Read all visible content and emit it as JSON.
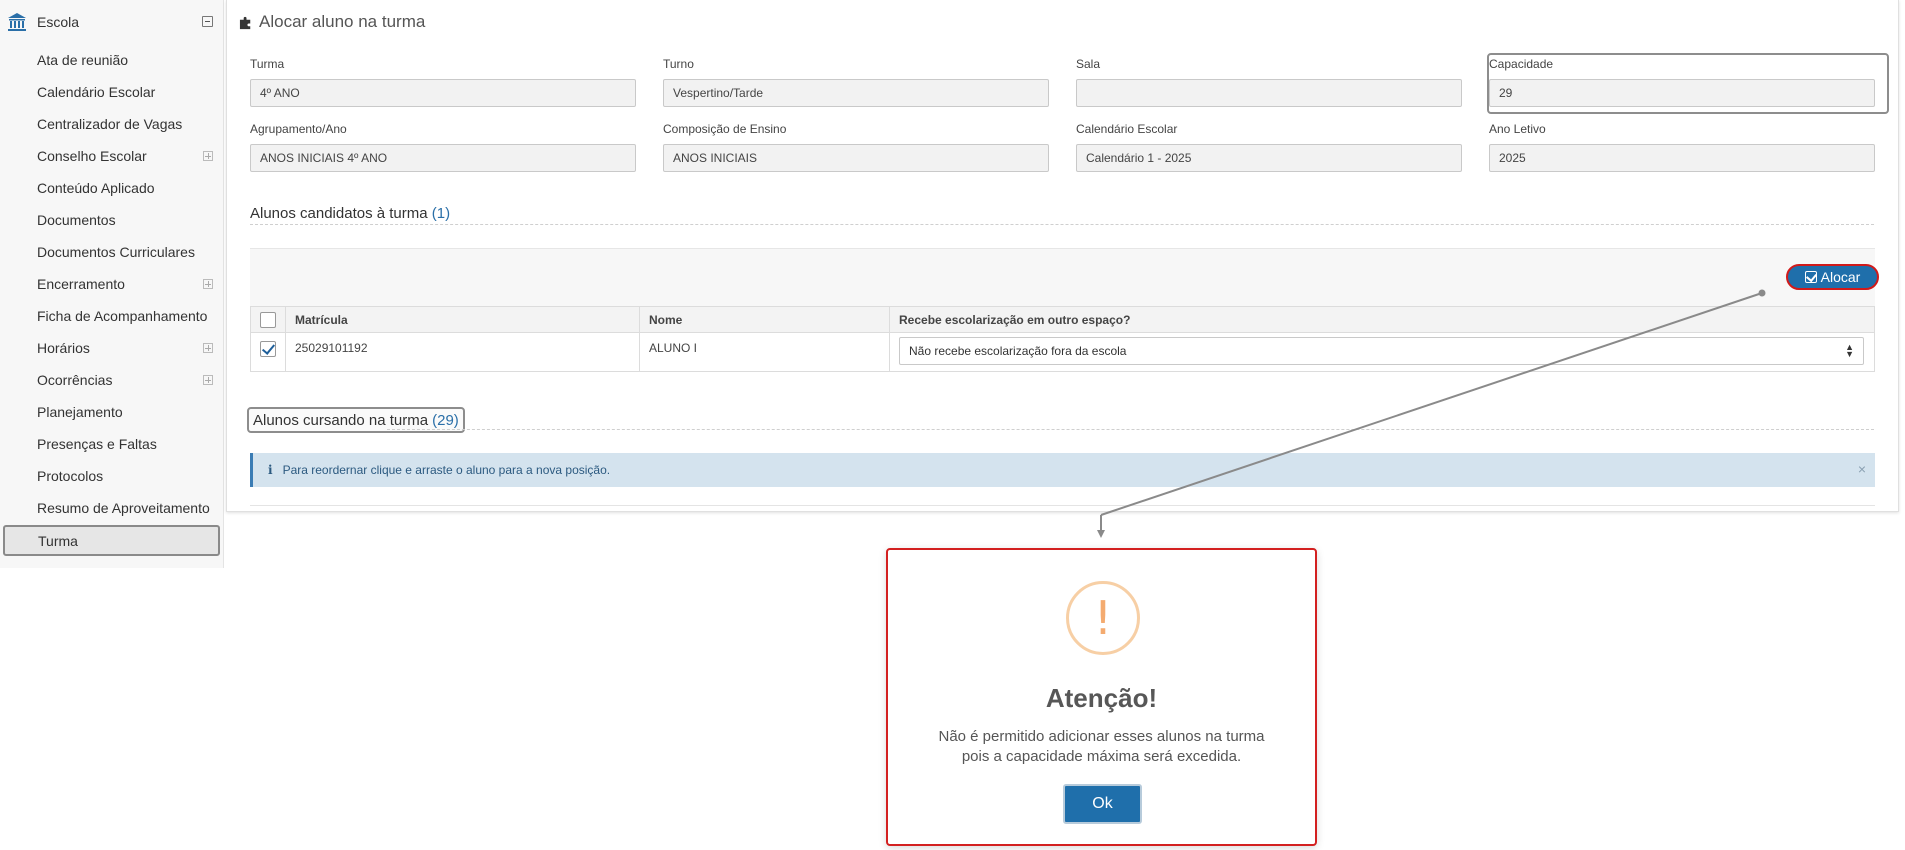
{
  "sidebar": {
    "title": "Escola",
    "items": [
      {
        "label": "Ata de reunião",
        "expandable": false
      },
      {
        "label": "Calendário Escolar",
        "expandable": false
      },
      {
        "label": "Centralizador de Vagas",
        "expandable": false
      },
      {
        "label": "Conselho Escolar",
        "expandable": true
      },
      {
        "label": "Conteúdo Aplicado",
        "expandable": false
      },
      {
        "label": "Documentos",
        "expandable": false
      },
      {
        "label": "Documentos Curriculares",
        "expandable": false
      },
      {
        "label": "Encerramento",
        "expandable": true
      },
      {
        "label": "Ficha de Acompanhamento",
        "expandable": false
      },
      {
        "label": "Horários",
        "expandable": true
      },
      {
        "label": "Ocorrências",
        "expandable": true
      },
      {
        "label": "Planejamento",
        "expandable": false
      },
      {
        "label": "Presenças e Faltas",
        "expandable": false
      },
      {
        "label": "Protocolos",
        "expandable": false
      },
      {
        "label": "Resumo de Aproveitamento",
        "expandable": false
      },
      {
        "label": "Turma",
        "expandable": false,
        "active": true
      }
    ]
  },
  "page": {
    "title": "Alocar aluno na turma"
  },
  "form": {
    "turma": {
      "label": "Turma",
      "value": "4º ANO"
    },
    "turno": {
      "label": "Turno",
      "value": "Vespertino/Tarde"
    },
    "sala": {
      "label": "Sala",
      "value": ""
    },
    "capacidade": {
      "label": "Capacidade",
      "value": "29"
    },
    "agrupamento": {
      "label": "Agrupamento/Ano",
      "value": "ANOS INICIAIS 4º ANO"
    },
    "composicao": {
      "label": "Composição de Ensino",
      "value": "ANOS INICIAIS"
    },
    "calendario": {
      "label": "Calendário Escolar",
      "value": "Calendário 1 - 2025"
    },
    "ano_letivo": {
      "label": "Ano Letivo",
      "value": "2025"
    }
  },
  "candidatos": {
    "title": "Alunos candidatos à turma",
    "count": "(1)",
    "alocar_label": "Alocar",
    "columns": [
      "Matrícula",
      "Nome",
      "Recebe escolarização em outro espaço?"
    ],
    "rows": [
      {
        "matricula": "25029101192",
        "nome": "ALUNO I",
        "escolarizacao": "Não recebe escolarização fora da escola",
        "checked": true
      }
    ]
  },
  "cursando": {
    "title": "Alunos cursando na turma",
    "count": "(29)",
    "info": "Para reordernar clique e arraste o aluno para a nova posição."
  },
  "modal": {
    "icon": "!",
    "title": "Atenção!",
    "line1": "Não é permitido adicionar esses alunos na turma",
    "line2": "pois a capacidade máxima será excedida.",
    "ok_label": "Ok"
  },
  "colors": {
    "primary": "#1f6fab",
    "highlight_red": "#d32020",
    "warning": "#f4ab70"
  }
}
